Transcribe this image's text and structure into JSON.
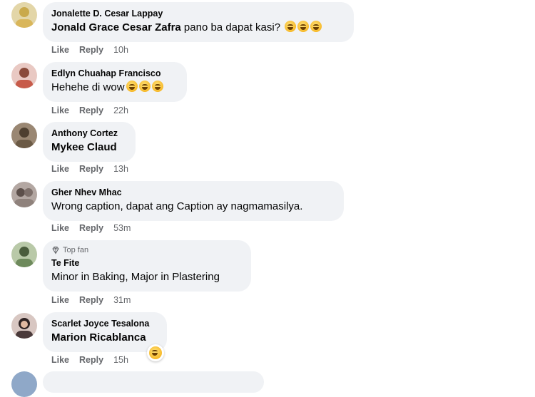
{
  "comments": [
    {
      "author": "Jonalette D. Cesar Lappay",
      "tag": "Jonald Grace Cesar Zafra",
      "text": " pano ba dapat kasi?",
      "emojis": [
        "laughing-crying-emoji",
        "grinning-emoji",
        "grinning-emoji"
      ],
      "like": "Like",
      "reply": "Reply",
      "time": "10h",
      "avatar_color": "#c9a94b"
    },
    {
      "author": "Edlyn Chuahap Francisco",
      "tag": "",
      "text": "Hehehe di wow",
      "emojis": [
        "laughing-crying-emoji",
        "laughing-crying-emoji",
        "laughing-crying-emoji"
      ],
      "like": "Like",
      "reply": "Reply",
      "time": "22h",
      "avatar_color": "#c75b4a"
    },
    {
      "author": "Anthony Cortez",
      "tag": "Mykee Claud",
      "text": "",
      "like": "Like",
      "reply": "Reply",
      "time": "13h",
      "avatar_color": "#6b5a45"
    },
    {
      "author": "Gher Nhev Mhac",
      "tag": "",
      "text": "Wrong caption, dapat ang Caption ay nagmamasilya.",
      "like": "Like",
      "reply": "Reply",
      "time": "53m",
      "avatar_color": "#7d6f6a"
    },
    {
      "badge": "Top fan",
      "author": "Te Fite",
      "tag": "",
      "text": "Minor in Baking, Major in Plastering",
      "like": "Like",
      "reply": "Reply",
      "time": "31m",
      "avatar_color": "#6e8a5c"
    },
    {
      "author": "Scarlet Joyce Tesalona",
      "tag": "Marion Ricablanca",
      "text": "",
      "like": "Like",
      "reply": "Reply",
      "time": "15h",
      "reaction": "haha-reaction-emoji",
      "avatar_color": "#4a3a3a"
    }
  ],
  "colors": {
    "bubble": "#f0f2f5",
    "meta_text": "#65676b",
    "primary_text": "#050505"
  }
}
